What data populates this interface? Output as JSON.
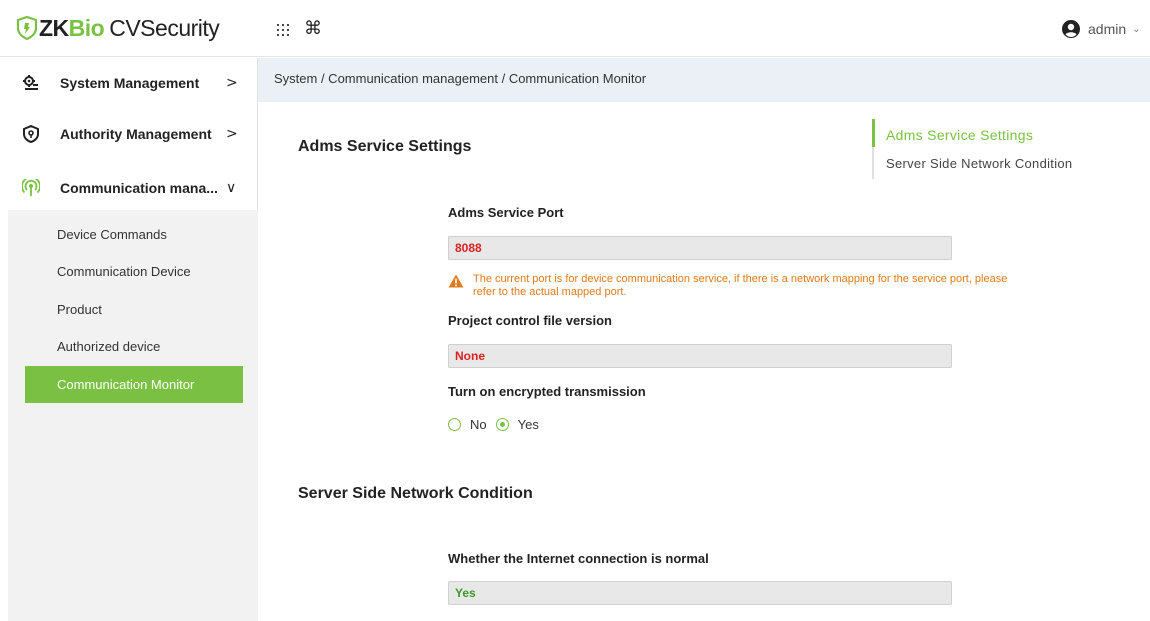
{
  "app": {
    "logo_zk": "ZK",
    "logo_bio": "Bio",
    "logo_cv": "CVSecurity",
    "command_icon": "⌘",
    "user_name": "admin",
    "accent_color": "#7ac143"
  },
  "sidebar": {
    "groups": [
      {
        "label": "System Management",
        "icon": "system-management-icon",
        "chevron": ">"
      },
      {
        "label": "Authority Management",
        "icon": "authority-management-icon",
        "chevron": ">"
      },
      {
        "label": "Communication mana...",
        "icon": "communication-icon",
        "chevron": "∨"
      }
    ],
    "items": [
      {
        "label": "Device Commands"
      },
      {
        "label": "Communication Device"
      },
      {
        "label": "Product"
      },
      {
        "label": "Authorized device"
      },
      {
        "label": "Communication Monitor",
        "active": true
      }
    ],
    "collapse_glyph": "«"
  },
  "breadcrumb": "System / Communication management / Communication Monitor",
  "anchor_nav": {
    "items": [
      {
        "label": "Adms Service Settings",
        "active": true
      },
      {
        "label": "Server Side Network Condition"
      }
    ]
  },
  "sections": {
    "adms": {
      "title": "Adms Service Settings",
      "port_label": "Adms Service Port",
      "port_value": "8088",
      "warning": "The current port is for device communication service, if there is a network mapping for the service port, please refer to the actual mapped port.",
      "version_label": "Project control file version",
      "version_value": "None",
      "encrypt_label": "Turn on encrypted transmission",
      "encrypt_options": [
        "No",
        "Yes"
      ],
      "encrypt_selected": "Yes"
    },
    "network": {
      "title": "Server Side Network Condition",
      "internet_label": "Whether the Internet connection is normal",
      "internet_value": "Yes"
    }
  }
}
